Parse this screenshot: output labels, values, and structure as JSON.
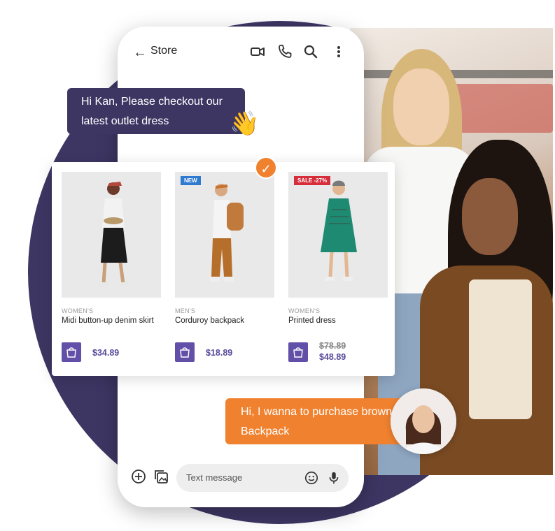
{
  "header": {
    "title": "Store",
    "icons": [
      "back-arrow-icon",
      "video-call-icon",
      "phone-icon",
      "search-icon",
      "more-vert-icon"
    ]
  },
  "messages": {
    "incoming": "Hi Kan, Please checkout our latest outlet dress",
    "outgoing": "Hi, I wanna to purchase brown Backpack"
  },
  "products": [
    {
      "category": "WOMEN'S",
      "name": "Midi button-up denim skirt",
      "price": "$34.89",
      "badge": ""
    },
    {
      "category": "MEN'S",
      "name": "Corduroy backpack",
      "price": "$18.89",
      "badge": "NEW"
    },
    {
      "category": "WOMEN'S",
      "name": "Printed dress",
      "old_price": "$78.89",
      "price": "$48.89",
      "badge": "SALE -27%"
    }
  ],
  "composer": {
    "placeholder": "Text message"
  },
  "colors": {
    "brand_dark": "#3d3663",
    "accent_orange": "#f0822f",
    "bag_purple": "#6250a8",
    "badge_new": "#2f7ad0",
    "badge_sale": "#d62d3b"
  }
}
